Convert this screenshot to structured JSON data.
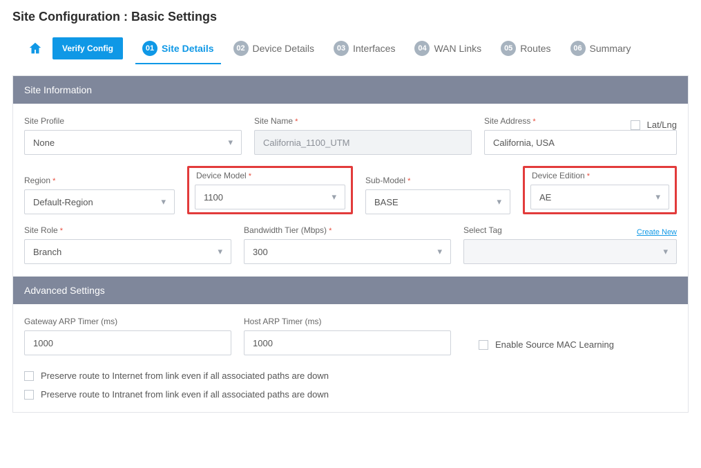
{
  "page": {
    "title": "Site Configuration : Basic Settings"
  },
  "wizard": {
    "verify_label": "Verify Config",
    "steps": [
      {
        "num": "01",
        "label": "Site Details"
      },
      {
        "num": "02",
        "label": "Device Details"
      },
      {
        "num": "03",
        "label": "Interfaces"
      },
      {
        "num": "04",
        "label": "WAN Links"
      },
      {
        "num": "05",
        "label": "Routes"
      },
      {
        "num": "06",
        "label": "Summary"
      }
    ]
  },
  "site_info": {
    "header": "Site Information",
    "site_profile": {
      "label": "Site Profile",
      "value": "None"
    },
    "site_name": {
      "label": "Site Name",
      "value": "California_1100_UTM"
    },
    "site_address": {
      "label": "Site Address",
      "value": "California, USA"
    },
    "latlng": {
      "label": "Lat/Lng"
    },
    "region": {
      "label": "Region",
      "value": "Default-Region"
    },
    "device_model": {
      "label": "Device Model",
      "value": "1100"
    },
    "sub_model": {
      "label": "Sub-Model",
      "value": "BASE"
    },
    "device_edition": {
      "label": "Device Edition",
      "value": "AE"
    },
    "site_role": {
      "label": "Site Role",
      "value": "Branch"
    },
    "bandwidth_tier": {
      "label": "Bandwidth Tier (Mbps)",
      "value": "300"
    },
    "select_tag": {
      "label": "Select Tag",
      "value": "",
      "create_new": "Create New"
    }
  },
  "advanced": {
    "header": "Advanced Settings",
    "gateway_arp": {
      "label": "Gateway ARP Timer (ms)",
      "value": "1000"
    },
    "host_arp": {
      "label": "Host ARP Timer (ms)",
      "value": "1000"
    },
    "mac_learning": {
      "label": "Enable Source MAC Learning"
    },
    "preserve_internet": "Preserve route to Internet from link even if all associated paths are down",
    "preserve_intranet": "Preserve route to Intranet from link even if all associated paths are down"
  }
}
